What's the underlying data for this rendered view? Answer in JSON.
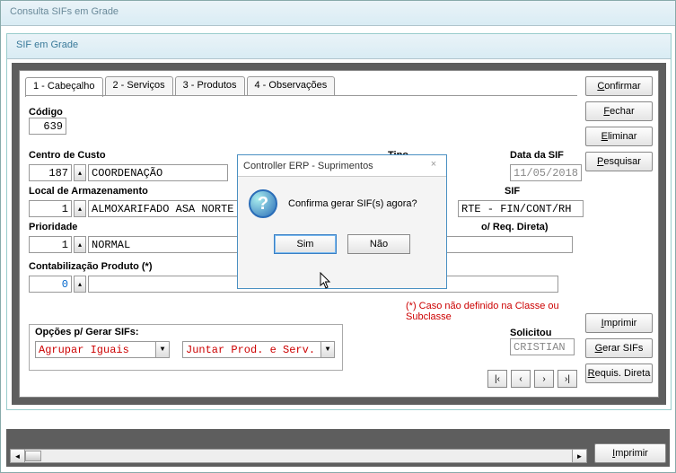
{
  "outerTitle": "Consulta SIFs em Grade",
  "innerTitle": "SIF em Grade",
  "tabs": [
    "1 - Cabeçalho",
    "2 - Serviços",
    "3 - Produtos",
    "4 - Observações"
  ],
  "rightButtons": {
    "confirmar": "Confirmar",
    "fechar": "Fechar",
    "eliminar": "Eliminar",
    "pesquisar": "Pesquisar",
    "imprimir": "Imprimir",
    "gerarSifs": "Gerar SIFs",
    "requisDireta": "Requis. Direta"
  },
  "labels": {
    "codigo": "Código",
    "centroCusto": "Centro de Custo",
    "tipo": "Tipo",
    "dataSif": "Data da SIF",
    "localArm": "Local de Armazenamento",
    "sif": "SIF",
    "prioridade": "Prioridade",
    "reqDireta": "o/ Req. Direta)",
    "rteLine": "RTE - FIN/CONT/RH",
    "contProd": "Contabilização Produto (*)",
    "opcoesGerar": "Opções p/ Gerar SIFs:",
    "solicitou": "Solicitou",
    "footnote": "(*) Caso não definido na Classe ou Subclasse"
  },
  "values": {
    "codigo": "639",
    "centroCustoNum": "187",
    "centroCustoTxt": "COORDENAÇÃO",
    "dataSif": "11/05/2018",
    "localNum": "1",
    "localTxt": "ALMOXARIFADO ASA NORTE",
    "prioNum": "1",
    "prioTxt": "NORMAL",
    "contNum": "0",
    "contTxt": "",
    "agrupar": "Agrupar Iguais",
    "juntar": "Juntar Prod. e Serv.",
    "solicitou": "CRISTIAN"
  },
  "modal": {
    "title": "Controller ERP - Suprimentos",
    "msg": "Confirma gerar SIF(s) agora?",
    "sim": "Sim",
    "nao": "Não"
  },
  "nav": {
    "first": "|‹",
    "prev": "‹",
    "next": "›",
    "last": "›|"
  },
  "bottomPrint": "Imprimir"
}
